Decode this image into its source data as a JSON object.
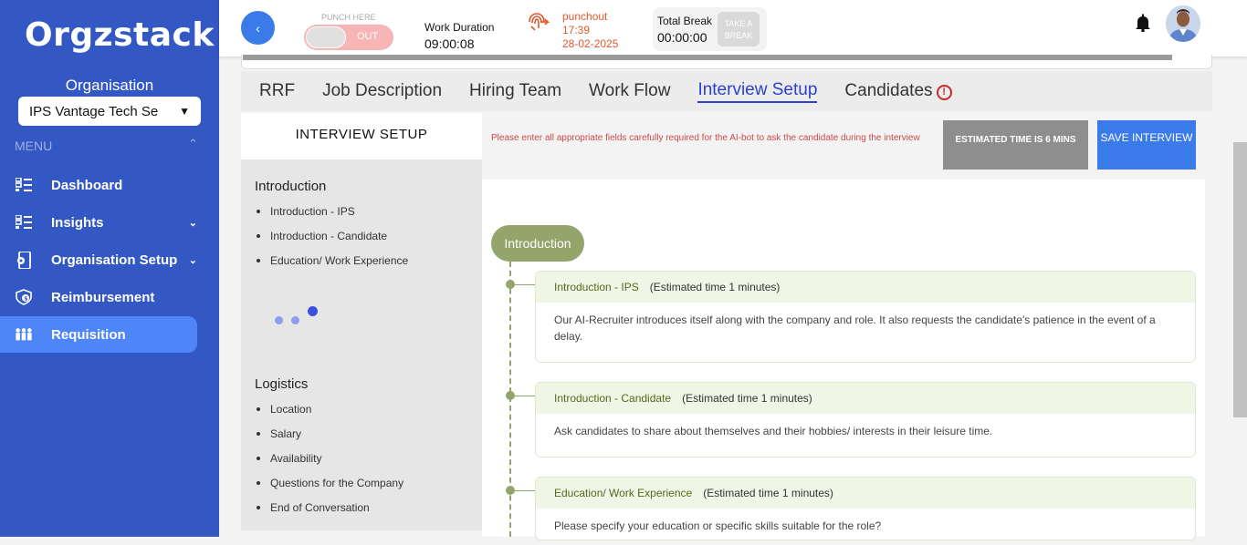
{
  "sidebar": {
    "logo": "Orgzstack",
    "org_label": "Organisation",
    "org_select": "IPS Vantage Tech Se",
    "menu_label": "MENU",
    "items": [
      {
        "label": "Dashboard",
        "icon": "list-icon"
      },
      {
        "label": "Insights",
        "icon": "list-icon"
      },
      {
        "label": "Organisation Setup",
        "icon": "mobile-settings-icon"
      },
      {
        "label": "Reimbursement",
        "icon": "shield-dollar-icon"
      },
      {
        "label": "Requisition",
        "icon": "people-icon"
      }
    ]
  },
  "header": {
    "back_icon": "‹",
    "punch_here": "PUNCH HERE",
    "punch_state": "OUT",
    "work_duration_label": "Work Duration",
    "work_duration_value": "09:00:08",
    "punchout_label": "punchout",
    "punchout_time": "17:39",
    "punchout_date": "28-02-2025",
    "total_break_label": "Total Break",
    "total_break_value": "00:00:00",
    "take_break_label": "TAKE A BREAK"
  },
  "tabs": [
    "RRF",
    "Job Description",
    "Hiring Team",
    "Work Flow",
    "Interview Setup",
    "Candidates"
  ],
  "active_tab": "Interview Setup",
  "left_panel": {
    "title": "INTERVIEW SETUP",
    "sections": [
      {
        "title": "Introduction",
        "items": [
          "Introduction - IPS",
          "Introduction - Candidate",
          "Education/ Work Experience"
        ]
      },
      {
        "title": "Logistics",
        "items": [
          "Location",
          "Salary",
          "Availability",
          "Questions for the Company",
          "End of Conversation"
        ]
      }
    ]
  },
  "notice": "Please enter all appropriate fields carefully required for the AI-bot to ask the candidate during the interview",
  "estimated_time_label": "ESTIMATED TIME IS 6 MINS",
  "save_label": "SAVE INTERVIEW",
  "flow": {
    "section": "Introduction",
    "cards": [
      {
        "title": "Introduction - IPS",
        "estimate": "(Estimated time 1 minutes)",
        "body": "Our AI-Recruiter introduces itself along with the company and role. It also requests the candidate's patience in the event of a delay."
      },
      {
        "title": "Introduction - Candidate",
        "estimate": "(Estimated time 1 minutes)",
        "body": "Ask candidates to share about themselves and their hobbies/ interests in their leisure time."
      },
      {
        "title": "Education/ Work Experience",
        "estimate": "(Estimated time 1 minutes)",
        "body": "Please specify your education or specific skills suitable for the role?"
      }
    ]
  },
  "colors": {
    "sidebar": "#3358c4",
    "active_nav": "#4f86f7",
    "accent": "#3b7be9",
    "flow_green": "#93a56a"
  }
}
